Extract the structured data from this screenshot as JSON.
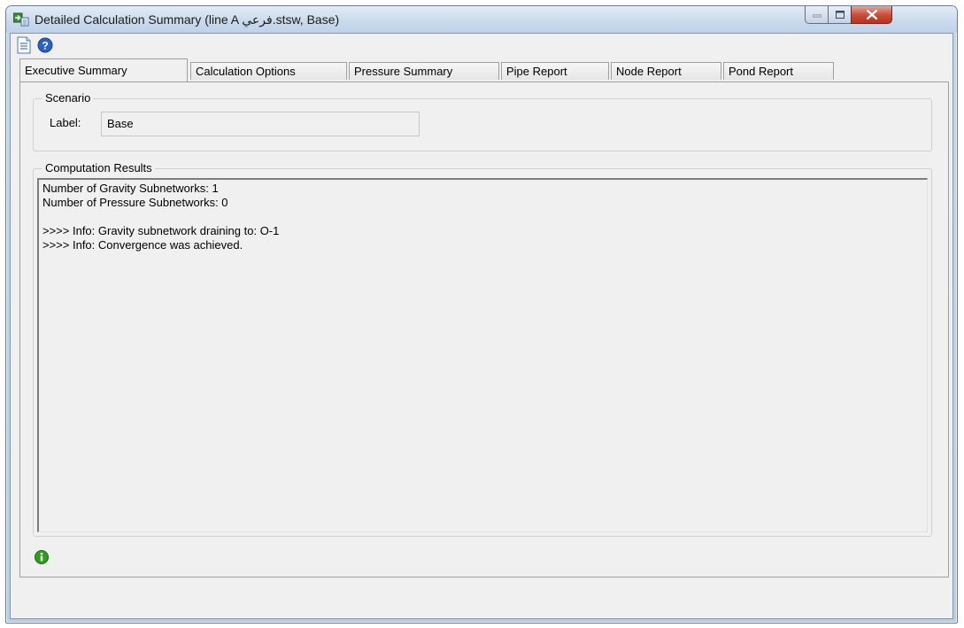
{
  "window": {
    "title": "Detailed Calculation Summary (line A فرعي.stsw, Base)"
  },
  "toolbar": {
    "icons": [
      "report-icon",
      "help-icon"
    ]
  },
  "tabs": [
    {
      "label": "Executive Summary",
      "active": true
    },
    {
      "label": "Calculation Options",
      "active": false
    },
    {
      "label": "Pressure Summary",
      "active": false
    },
    {
      "label": "Pipe Report",
      "active": false
    },
    {
      "label": "Node Report",
      "active": false
    },
    {
      "label": "Pond Report",
      "active": false
    }
  ],
  "scenario": {
    "group_title": "Scenario",
    "label_caption": "Label:",
    "label_value": "Base"
  },
  "results": {
    "group_title": "Computation Results",
    "lines": [
      "Number of Gravity Subnetworks: 1",
      "Number of Pressure Subnetworks: 0",
      "",
      ">>>> Info: Gravity subnetwork draining to: O-1",
      ">>>> Info: Convergence was achieved."
    ]
  },
  "status": {
    "icon": "info-icon",
    "color": "#2e9d1e"
  },
  "colors": {
    "close_button": "#c9503c",
    "help_icon": "#2b62c9"
  }
}
